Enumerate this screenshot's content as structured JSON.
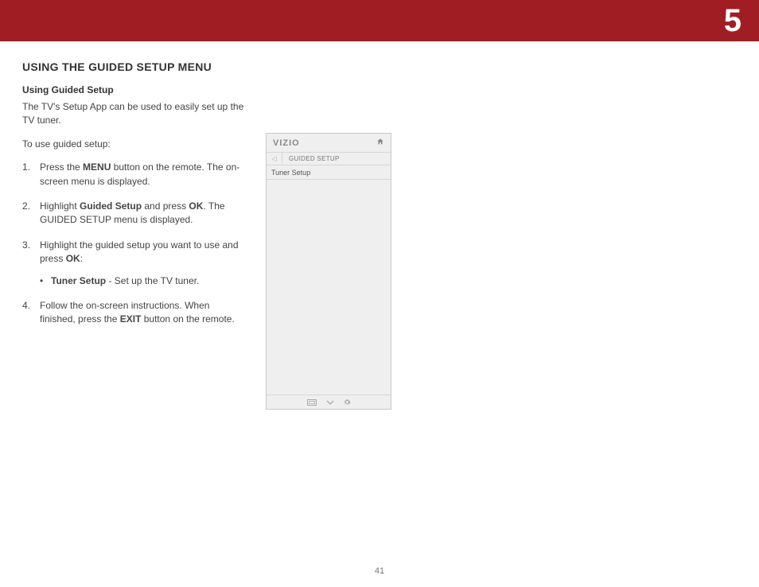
{
  "chapter_number": "5",
  "section_title": "USING THE GUIDED SETUP MENU",
  "subheading": "Using Guided Setup",
  "intro": "The TV's Setup App can be used to easily set up the TV tuner.",
  "to_use": "To use guided setup:",
  "steps": {
    "s1_a": "Press the ",
    "s1_b": "MENU",
    "s1_c": " button on the remote. The on-screen menu is displayed.",
    "s2_a": "Highlight ",
    "s2_b": "Guided Setup",
    "s2_c": " and press ",
    "s2_d": "OK",
    "s2_e": ". The GUIDED SETUP menu is displayed.",
    "s3_a": "Highlight the guided setup you want to use and press ",
    "s3_b": "OK",
    "s3_c": ":",
    "bullet_a": "Tuner Setup",
    "bullet_b": " - Set up the TV tuner.",
    "s4_a": "Follow the on-screen instructions. When finished, press the ",
    "s4_b": "EXIT",
    "s4_c": " button on the remote."
  },
  "tv": {
    "logo": "VIZIO",
    "breadcrumb": "GUIDED SETUP",
    "item1": "Tuner Setup"
  },
  "page_number": "41"
}
